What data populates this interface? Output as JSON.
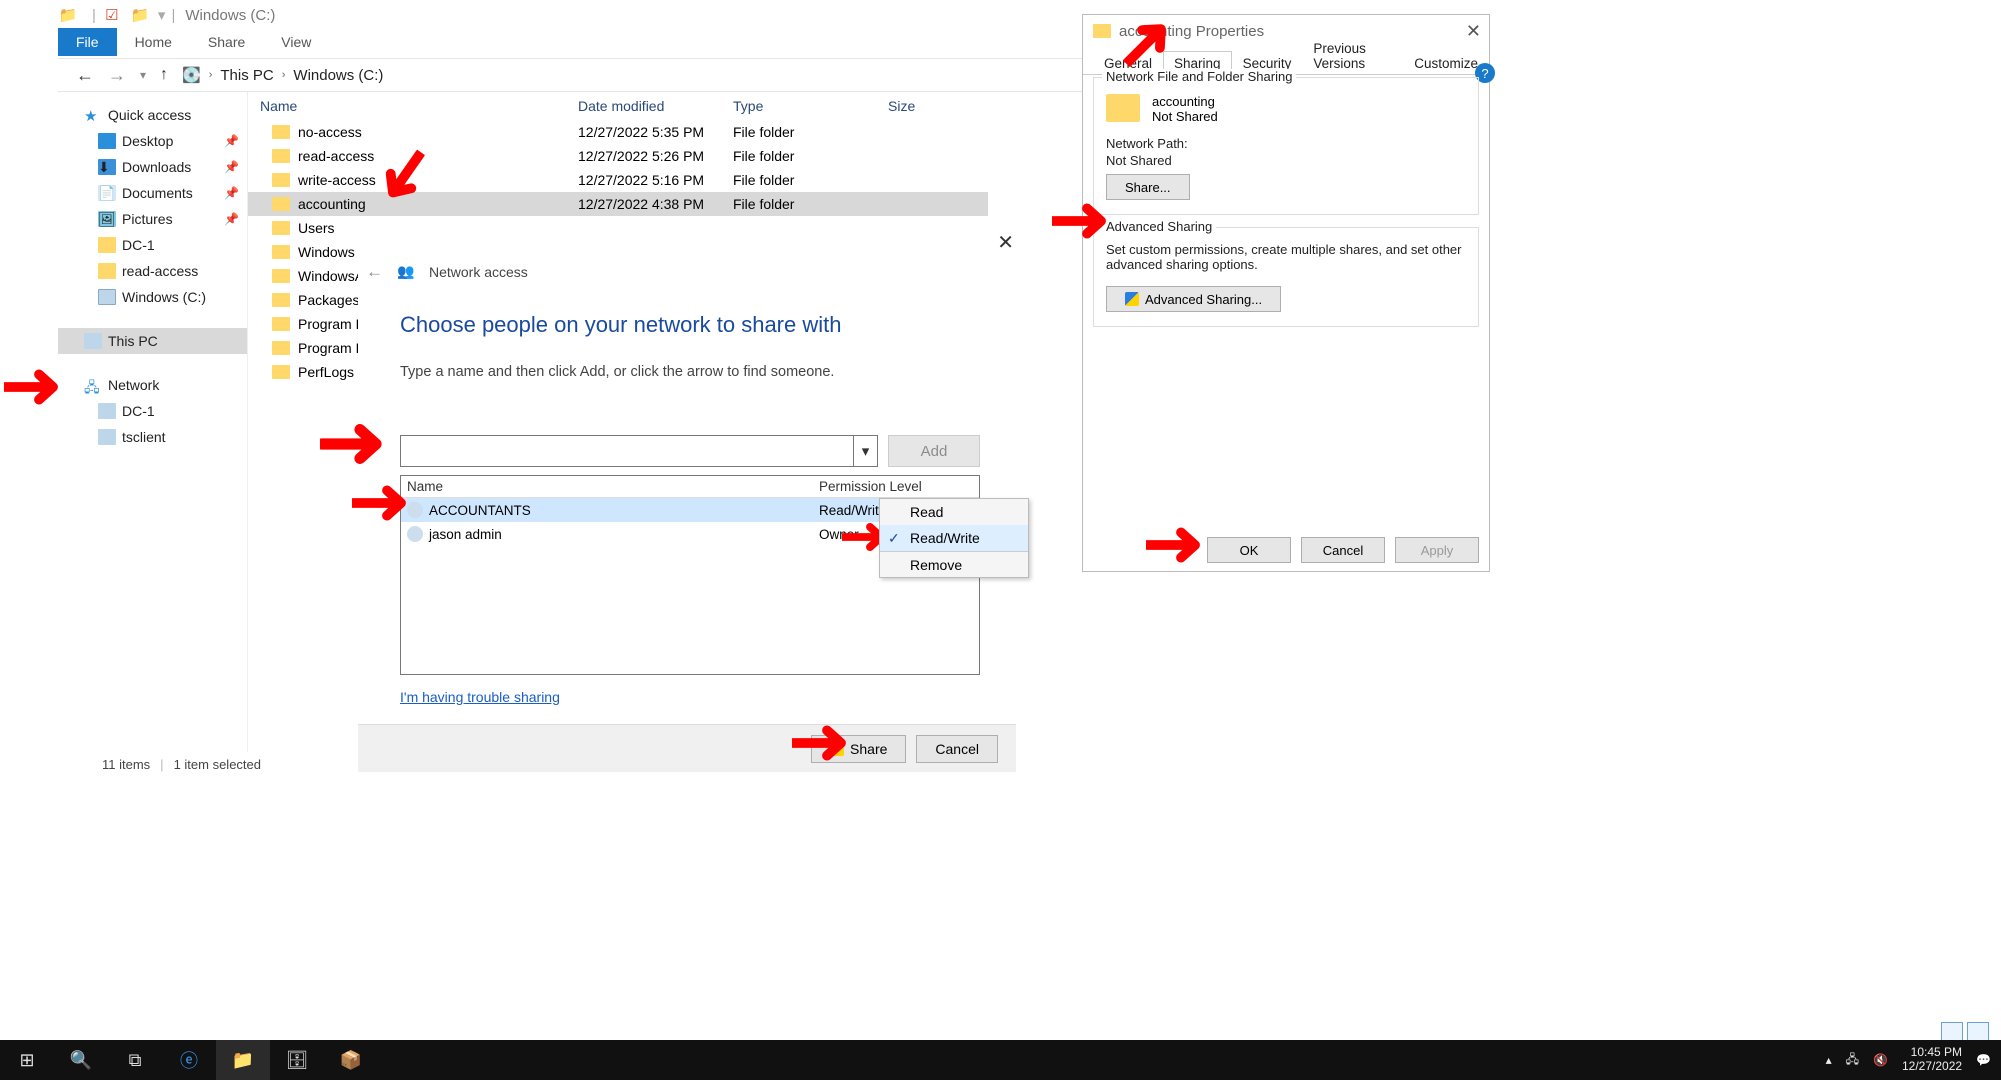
{
  "titlebar": {
    "title": "Windows (C:)"
  },
  "ribbon": {
    "file": "File",
    "home": "Home",
    "share": "Share",
    "view": "View"
  },
  "breadcrumb": {
    "root": "This PC",
    "drive": "Windows (C:)"
  },
  "sidebar": {
    "quick": "Quick access",
    "desktop": "Desktop",
    "downloads": "Downloads",
    "documents": "Documents",
    "pictures": "Pictures",
    "dc1": "DC-1",
    "readaccess": "read-access",
    "cdrive": "Windows (C:)",
    "thispc": "This PC",
    "network": "Network",
    "net_dc1": "DC-1",
    "net_ts": "tsclient"
  },
  "columns": {
    "name": "Name",
    "date": "Date modified",
    "type": "Type",
    "size": "Size"
  },
  "files": [
    {
      "name": "no-access",
      "date": "12/27/2022 5:35 PM",
      "type": "File folder"
    },
    {
      "name": "read-access",
      "date": "12/27/2022 5:26 PM",
      "type": "File folder"
    },
    {
      "name": "write-access",
      "date": "12/27/2022 5:16 PM",
      "type": "File folder"
    },
    {
      "name": "accounting",
      "date": "12/27/2022 4:38 PM",
      "type": "File folder",
      "selected": true
    },
    {
      "name": "Users",
      "date": "",
      "type": ""
    },
    {
      "name": "Windows",
      "date": "",
      "type": ""
    },
    {
      "name": "WindowsAzu",
      "date": "",
      "type": ""
    },
    {
      "name": "Packages",
      "date": "",
      "type": ""
    },
    {
      "name": "Program File",
      "date": "",
      "type": ""
    },
    {
      "name": "Program File",
      "date": "",
      "type": ""
    },
    {
      "name": "PerfLogs",
      "date": "",
      "type": ""
    }
  ],
  "status": {
    "items": "11 items",
    "selected": "1 item selected"
  },
  "wizard": {
    "title": "Network access",
    "heading": "Choose people on your network to share with",
    "sub": "Type a name and then click Add, or click the arrow to find someone.",
    "add_btn": "Add",
    "col_name": "Name",
    "col_perm": "Permission Level",
    "row0_name": "ACCOUNTANTS",
    "row0_perm": "Read/Write",
    "row1_name": "jason admin",
    "row1_perm": "Owner",
    "menu_read": "Read",
    "menu_rw": "Read/Write",
    "menu_remove": "Remove",
    "trouble": "I'm having trouble sharing",
    "btn_share": "Share",
    "btn_cancel": "Cancel"
  },
  "prop": {
    "title": "accounting Properties",
    "tab_general": "General",
    "tab_sharing": "Sharing",
    "tab_security": "Security",
    "tab_prev": "Previous Versions",
    "tab_custom": "Customize",
    "legend1": "Network File and Folder Sharing",
    "folder_name": "accounting",
    "folder_status": "Not Shared",
    "netpath_label": "Network Path:",
    "netpath_value": "Not Shared",
    "share_btn": "Share...",
    "legend2": "Advanced Sharing",
    "adv_text": "Set custom permissions, create multiple shares, and set other advanced sharing options.",
    "adv_btn": "Advanced Sharing...",
    "ok": "OK",
    "cancel": "Cancel",
    "apply": "Apply"
  },
  "tray": {
    "time": "10:45 PM",
    "date": "12/27/2022"
  }
}
